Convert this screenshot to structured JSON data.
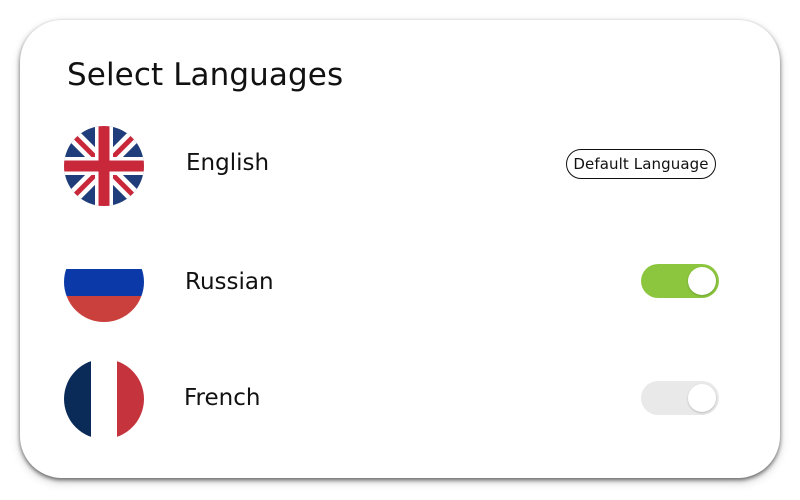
{
  "dialog": {
    "title": "Select Languages"
  },
  "languages": [
    {
      "name": "English",
      "flag_icon": "uk-flag-icon",
      "badge": "Default Language"
    },
    {
      "name": "Russian",
      "flag_icon": "russia-flag-icon",
      "toggle_on": true
    },
    {
      "name": "French",
      "flag_icon": "france-flag-icon",
      "toggle_on": false
    }
  ],
  "colors": {
    "toggle_on": "#8cc63f",
    "toggle_off": "#e9e9e9",
    "uk_blue": "#1f3d7a",
    "uk_red": "#c8283a",
    "russia_blue": "#0b39a8",
    "russia_red": "#c9403d",
    "france_blue": "#0a2a57",
    "france_red": "#c5333c"
  }
}
